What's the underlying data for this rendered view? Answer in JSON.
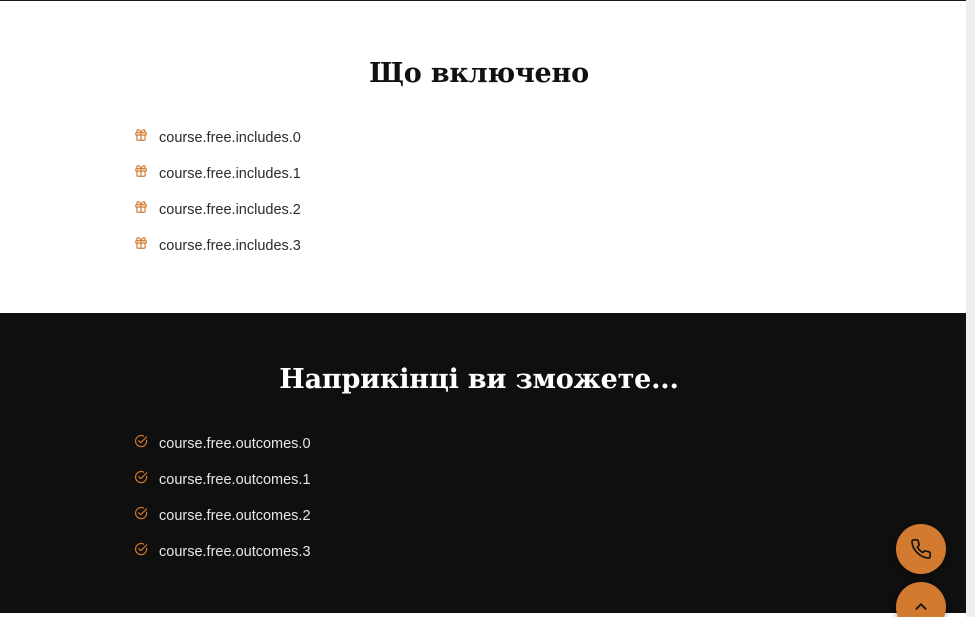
{
  "includes": {
    "title": "Що включено",
    "items": [
      "course.free.includes.0",
      "course.free.includes.1",
      "course.free.includes.2",
      "course.free.includes.3"
    ]
  },
  "outcomes": {
    "title": "Наприкінці ви зможете...",
    "items": [
      "course.free.outcomes.0",
      "course.free.outcomes.1",
      "course.free.outcomes.2",
      "course.free.outcomes.3"
    ]
  },
  "icons": {
    "include_item": "gift-icon",
    "outcome_item": "check-circle-icon",
    "call_button": "phone-icon",
    "scroll_top_button": "chevron-up-icon"
  },
  "colors": {
    "accent": "#d27a30",
    "dark_section_bg": "#0f0f0f",
    "light_section_bg": "#ffffff"
  }
}
